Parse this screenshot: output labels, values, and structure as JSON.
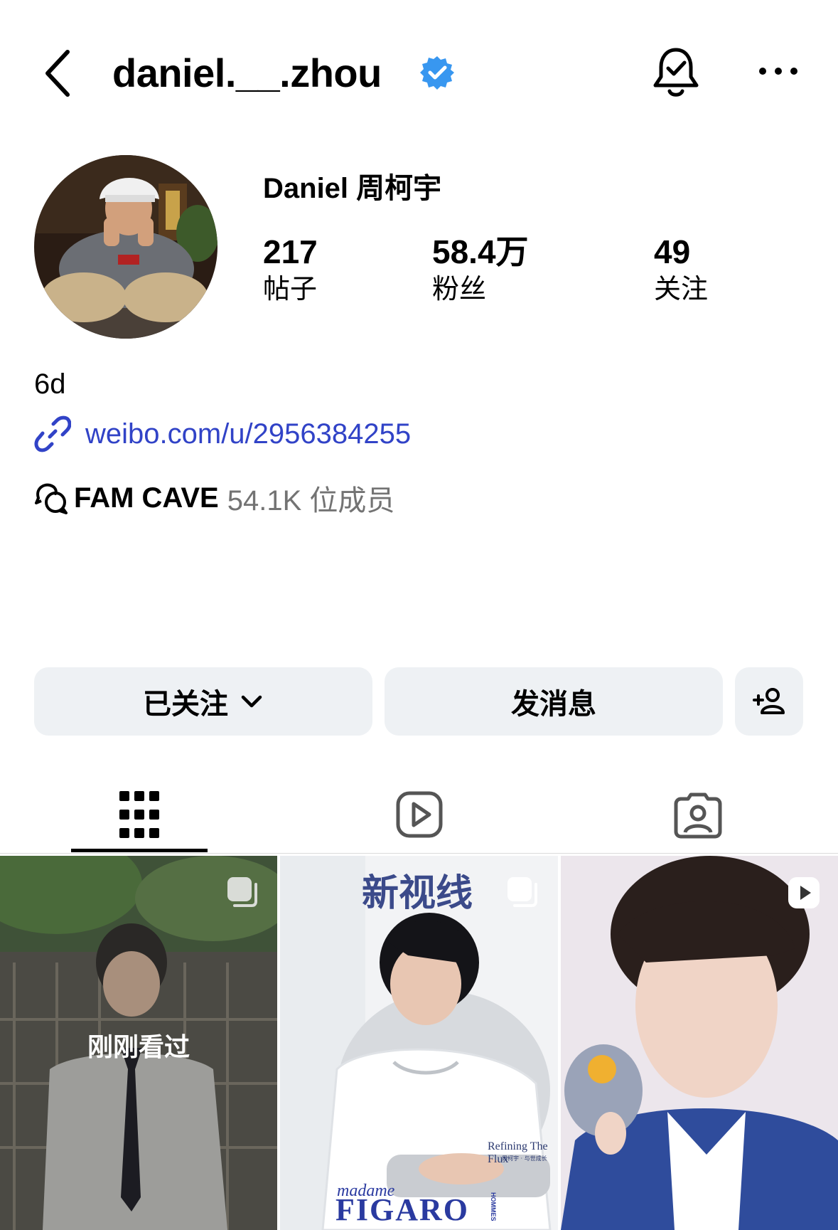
{
  "header": {
    "username": "daniel.__.zhou",
    "back_icon": "chevron-left-icon",
    "verified_icon": "verified-badge-icon",
    "bell_icon": "notification-bell-icon",
    "more_icon": "more-horizontal-icon"
  },
  "profile": {
    "display_name": "Daniel 周柯宇",
    "stats": [
      {
        "value": "217",
        "label": "帖子"
      },
      {
        "value": "58.4万",
        "label": "粉丝"
      },
      {
        "value": "49",
        "label": "关注"
      }
    ],
    "bio": "6d",
    "link": "weibo.com/u/2956384255",
    "channel_name": "FAM CAVE",
    "channel_members": "54.1K 位成员"
  },
  "actions": {
    "following_label": "已关注",
    "message_label": "发消息"
  },
  "tabs": [
    "grid-icon",
    "reels-icon",
    "tagged-icon"
  ],
  "posts": [
    {
      "overlay_text": "刚刚看过",
      "badge": "carousel-icon"
    },
    {
      "title_text": "新视线",
      "subtitle_text": "Refining The Flux",
      "subtitle2_text": "周柯宇 · 与世成长",
      "magazine_small": "madame",
      "magazine_big": "FIGARO",
      "magazine_vertical": "HOMMES",
      "badge": "carousel-icon"
    },
    {
      "badge": "reel-icon"
    }
  ],
  "colors": {
    "link": "#3143c7",
    "verified": "#3897f0",
    "button_bg": "#eef1f4"
  }
}
